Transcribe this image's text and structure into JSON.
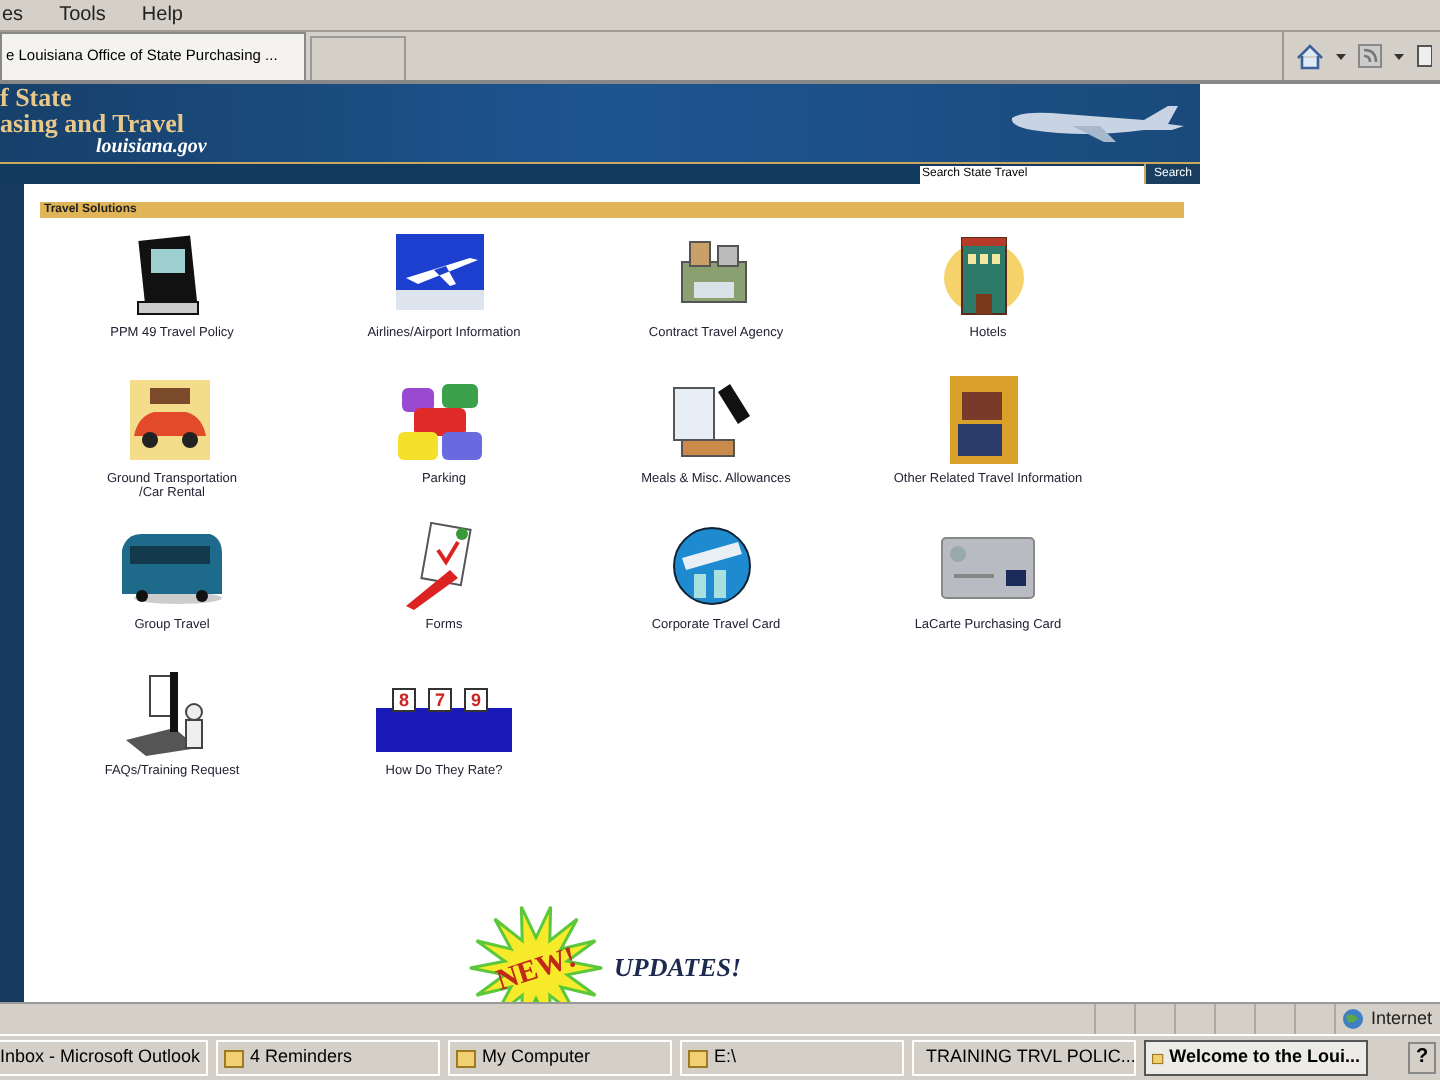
{
  "menu_bar": [
    "es",
    "Tools",
    "Help"
  ],
  "tabs": [
    {
      "label": "e Louisiana Office of State Purchasing ...",
      "selected": true
    },
    {
      "selected": false
    }
  ],
  "banner": {
    "title_lines": [
      "f State",
      "asing and Travel"
    ],
    "subtitle": "louisiana.gov"
  },
  "search": {
    "value": "Search State Travel",
    "button": "Search"
  },
  "section": {
    "title": "Travel Solutions"
  },
  "links": [
    {
      "label": "PPM 49 Travel Policy",
      "kind": "book"
    },
    {
      "label": "Airlines/Airport Information",
      "kind": "plane"
    },
    {
      "label": "Contract Travel Agency",
      "kind": "agency"
    },
    {
      "label": "Hotels",
      "kind": "hotel"
    },
    {
      "label": "Ground Transportation\n/Car Rental",
      "kind": "car"
    },
    {
      "label": "Parking",
      "kind": "traffic"
    },
    {
      "label": "Meals & Misc. Allowances",
      "kind": "meals"
    },
    {
      "label": "Other Related Travel Information",
      "kind": "luggage"
    },
    {
      "label": "Group Travel",
      "kind": "bus"
    },
    {
      "label": "Forms",
      "kind": "forms"
    },
    {
      "label": "Corporate Travel Card",
      "kind": "globe"
    },
    {
      "label": "LaCarte Purchasing Card",
      "kind": "card"
    },
    {
      "label": "FAQs/Training Request",
      "kind": "faq"
    },
    {
      "label": "How Do They Rate?",
      "kind": "judges"
    }
  ],
  "judges_scores": [
    "8",
    "7",
    "9"
  ],
  "updates": {
    "badge": "NEW!",
    "label": "UPDATES!"
  },
  "status_bar": {
    "zone": "Internet"
  },
  "taskbar": [
    {
      "label": "Inbox - Microsoft Outlook",
      "selected": false
    },
    {
      "label": "4 Reminders",
      "selected": false
    },
    {
      "label": "My Computer",
      "selected": false
    },
    {
      "label": "E:\\",
      "selected": false
    },
    {
      "label": "TRAINING TRVL POLIC...",
      "selected": false
    },
    {
      "label": "Welcome to the Loui...",
      "selected": true
    }
  ],
  "tray_help": "?"
}
